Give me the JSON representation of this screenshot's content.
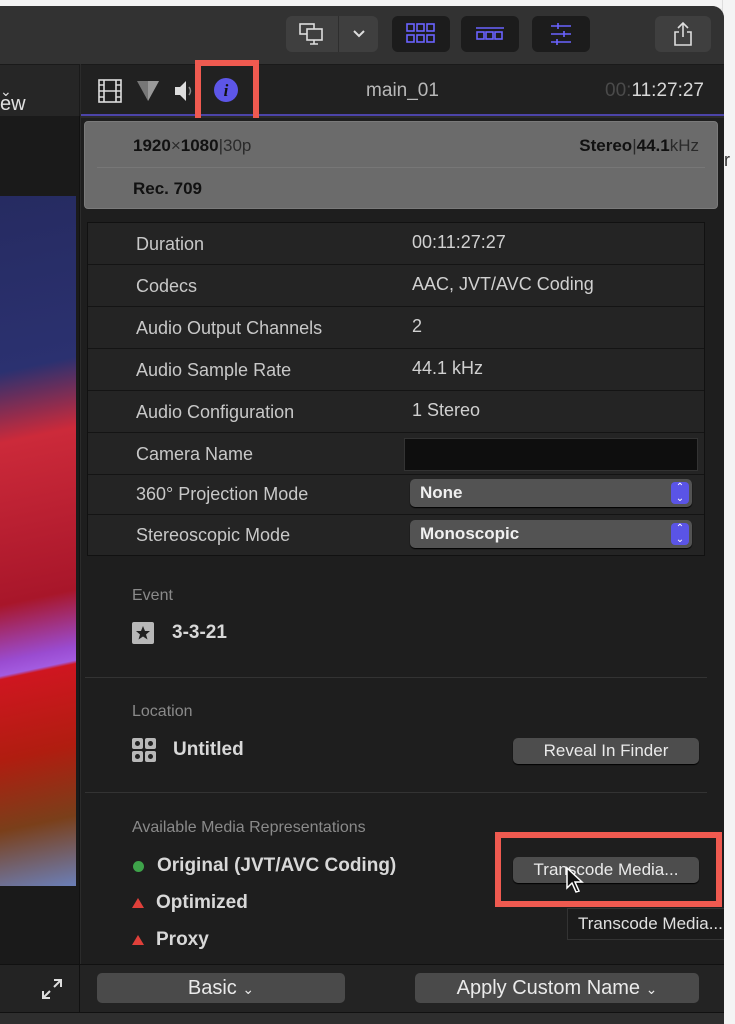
{
  "toolbar": {
    "buttons": [
      {
        "name": "viewer-display-toggle",
        "icon": "display-icon"
      },
      {
        "name": "viewer-display-menu",
        "icon": "chevron-down-icon"
      },
      {
        "name": "browser-toggle",
        "icon": "grid-icon"
      },
      {
        "name": "timeline-toggle",
        "icon": "timeline-icon"
      },
      {
        "name": "inspector-toggle",
        "icon": "sliders-icon"
      },
      {
        "name": "share",
        "icon": "share-icon"
      }
    ],
    "accent_color": "#6a63ff"
  },
  "viewer": {
    "view_menu_label": "ew"
  },
  "inspector": {
    "tabs": [
      {
        "name": "video",
        "icon": "film-icon"
      },
      {
        "name": "color",
        "icon": "color-triangle-icon"
      },
      {
        "name": "audio",
        "icon": "speaker-icon"
      },
      {
        "name": "info",
        "icon": "info-icon",
        "active": true
      }
    ],
    "clip_name": "main_01",
    "timecode_dim": "00:",
    "timecode": "11:27:27",
    "summary": {
      "resolution_w": "1920",
      "resolution_x": "×",
      "resolution_h": "1080",
      "frame_rate": "30p",
      "audio_channels": "Stereo",
      "sample_rate_num": "44.1",
      "sample_rate_unit": "kHz",
      "color_space": "Rec. 709"
    },
    "properties": [
      {
        "label": "Duration",
        "value": "00:11:27:27"
      },
      {
        "label": "Codecs",
        "value": "AAC, JVT/AVC Coding"
      },
      {
        "label": "Audio Output Channels",
        "value": "2"
      },
      {
        "label": "Audio Sample Rate",
        "value": "44.1 kHz"
      },
      {
        "label": "Audio Configuration",
        "value": "1 Stereo"
      },
      {
        "label": "Camera Name",
        "value": ""
      },
      {
        "label": "360° Projection Mode",
        "value": "None"
      },
      {
        "label": "Stereoscopic Mode",
        "value": "Monoscopic"
      }
    ],
    "event": {
      "label": "Event",
      "value": "3-3-21"
    },
    "location": {
      "label": "Location",
      "value": "Untitled",
      "button": "Reveal In Finder"
    },
    "media": {
      "label": "Available Media Representations",
      "items": [
        {
          "text": "Original (JVT/AVC Coding)",
          "status": "available",
          "color": "#3ea34a"
        },
        {
          "text": "Optimized",
          "status": "missing",
          "color": "#e0403a"
        },
        {
          "text": "Proxy",
          "status": "missing",
          "color": "#e0403a"
        }
      ],
      "transcode_button": "Transcode Media...",
      "tooltip": "Transcode Media..."
    }
  },
  "bottom_bar": {
    "metadata_view": "Basic",
    "apply_name": "Apply Custom Name"
  },
  "annotation_color": "#ef5a50"
}
